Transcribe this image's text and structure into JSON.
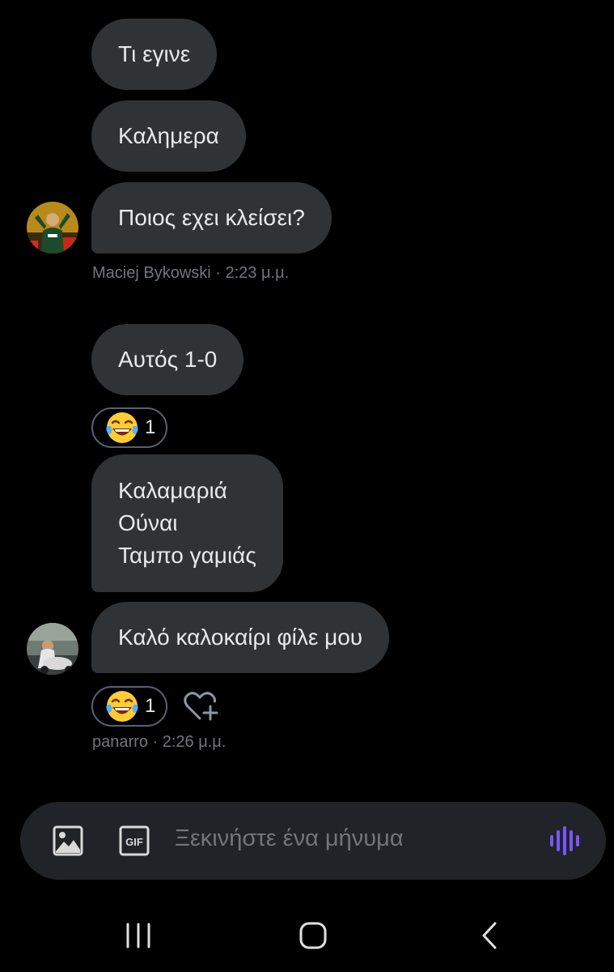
{
  "colors": {
    "background": "#000000",
    "bubble": "#2f3336",
    "text": "#e7e9ea",
    "meta": "#71767b",
    "accent": "#7856ff"
  },
  "messages": [
    {
      "text": "Τι εγινε"
    },
    {
      "text": "Καλημερα"
    },
    {
      "text": "Ποιος εχει κλείσει?"
    },
    {
      "text": "Αυτός 1-0"
    },
    {
      "lines": [
        "Καλαμαριά",
        "Ούναι",
        "Ταμπο γαμιάς"
      ]
    },
    {
      "text": "Καλό καλοκαίρι φίλε μου"
    }
  ],
  "meta_1": {
    "sender": "Maciej Bykowski",
    "time": "2:23 μ.μ.",
    "separator": "·"
  },
  "meta_2": {
    "sender": "panarro",
    "time": "2:26 μ.μ.",
    "separator": "·"
  },
  "reactions": [
    {
      "emoji": "face-with-tears-of-joy",
      "count": "1"
    },
    {
      "emoji": "face-with-tears-of-joy",
      "count": "1"
    }
  ],
  "composer": {
    "placeholder": "Ξεκινήστε ένα μήνυμα",
    "image_icon": "image-icon",
    "gif_icon": "gif-icon",
    "gif_label": "GIF",
    "voice_icon": "voice-message-icon"
  },
  "navbar": {
    "recents_icon": "recents-icon",
    "home_icon": "home-icon",
    "back_icon": "back-icon"
  }
}
